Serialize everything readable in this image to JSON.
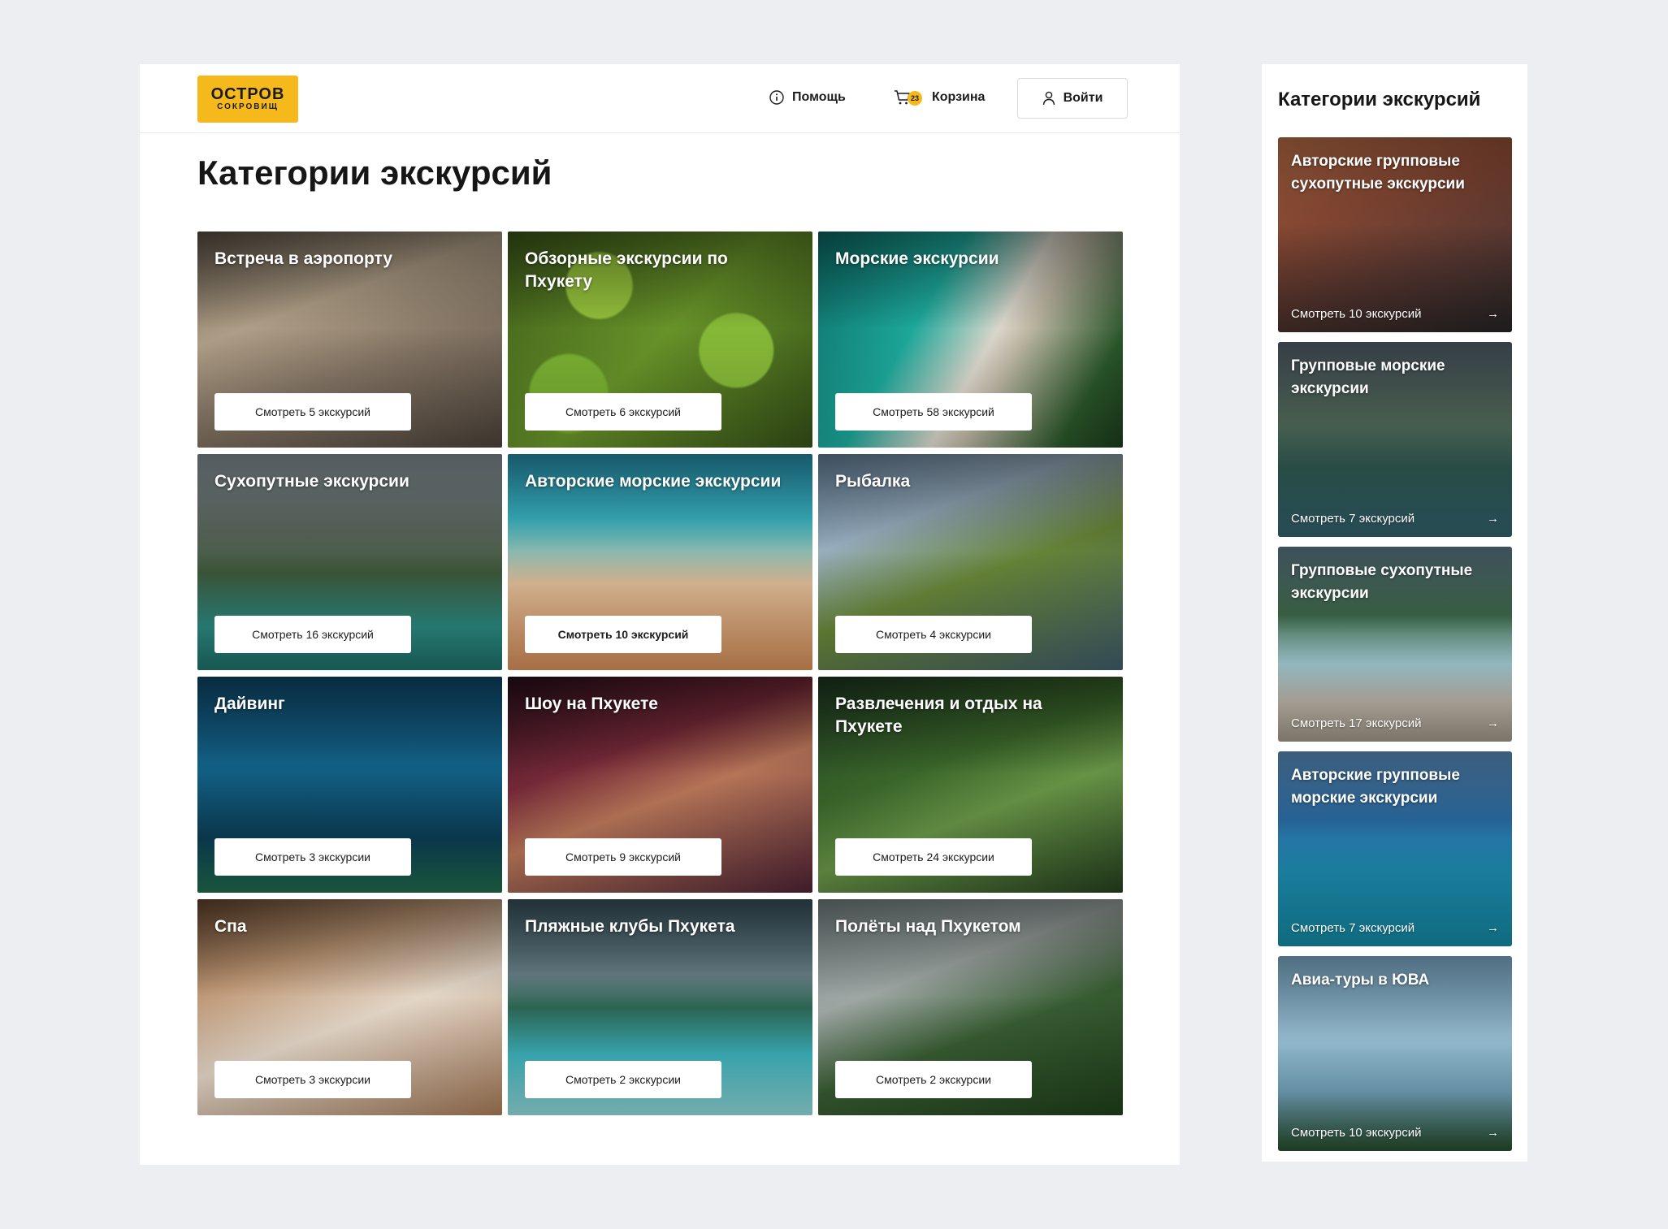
{
  "header": {
    "logo_main": "ОСТРОВ",
    "logo_sub": "СОКРОВИЩ",
    "help_label": "Помощь",
    "cart_label": "Корзина",
    "cart_count": "23",
    "login_label": "Войти"
  },
  "page": {
    "title": "Категории экскурсий"
  },
  "categories": [
    {
      "title": "Встреча в аэропорту",
      "button": "Смотреть 5 экскурсий",
      "image": "airport-traveler-photo"
    },
    {
      "title": "Обзорные экскурсии по Пхукету",
      "button": "Смотреть 6 экскурсий",
      "image": "boat-among-lily-pads-photo"
    },
    {
      "title": "Морские экскурсии",
      "button": "Смотреть 58 экскурсий",
      "image": "aerial-sandbar-photo"
    },
    {
      "title": "Сухопутные экскурсии",
      "button": "Смотреть 16 экскурсий",
      "image": "lake-rocks-woman-photo"
    },
    {
      "title": "Авторские морские экскурсии",
      "button": "Смотреть 10 экскурсий",
      "image": "coconut-beach-photo"
    },
    {
      "title": "Рыбалка",
      "button": "Смотреть 4 экскурсии",
      "image": "fishing-catch-photo"
    },
    {
      "title": "Дайвинг",
      "button": "Смотреть 3 экскурсии",
      "image": "divers-reef-photo"
    },
    {
      "title": "Шоу на Пхукете",
      "button": "Смотреть 9 экскурсий",
      "image": "cabaret-show-photo"
    },
    {
      "title": "Развлечения и отдых на Пхукете",
      "button": "Смотреть 24 экскурсии",
      "image": "zipline-jungle-photo"
    },
    {
      "title": "Спа",
      "button": "Смотреть 3 экскурсии",
      "image": "spa-massage-photo"
    },
    {
      "title": "Пляжные клубы Пхукета",
      "button": "Смотреть 2 экскурсии",
      "image": "beach-club-pool-photo"
    },
    {
      "title": "Полёты над Пхукетом",
      "button": "Смотреть 2 экскурсии",
      "image": "helicopter-islands-photo"
    }
  ],
  "mobile": {
    "title": "Категории экскурсий",
    "cards": [
      {
        "title": "Авторские групповые сухопутные экскурсии",
        "link": "Смотреть 10 экскурсий",
        "image": "elephant-photo"
      },
      {
        "title": "Групповые морские экскурсии",
        "link": "Смотреть 7 экскурсий",
        "image": "longtail-boat-photo"
      },
      {
        "title": "Групповые сухопутные экскурсии",
        "link": "Смотреть 17 экскурсий",
        "image": "palm-beach-photo"
      },
      {
        "title": "Авторские групповые морские экскурсии",
        "link": "Смотреть 7 экскурсий",
        "image": "ferry-island-photo"
      },
      {
        "title": "Авиа-туры в ЮВА",
        "link": "Смотреть 10 экскурсий",
        "image": "airplane-sky-photo"
      }
    ]
  },
  "colors": {
    "accent": "#f5b91c",
    "background": "#eceef2",
    "surface": "#ffffff",
    "text": "#1c1c1c"
  },
  "icons": {
    "help": "info-circle-icon",
    "cart": "cart-icon",
    "login": "user-icon",
    "card_arrow": "arrow-right-icon"
  }
}
